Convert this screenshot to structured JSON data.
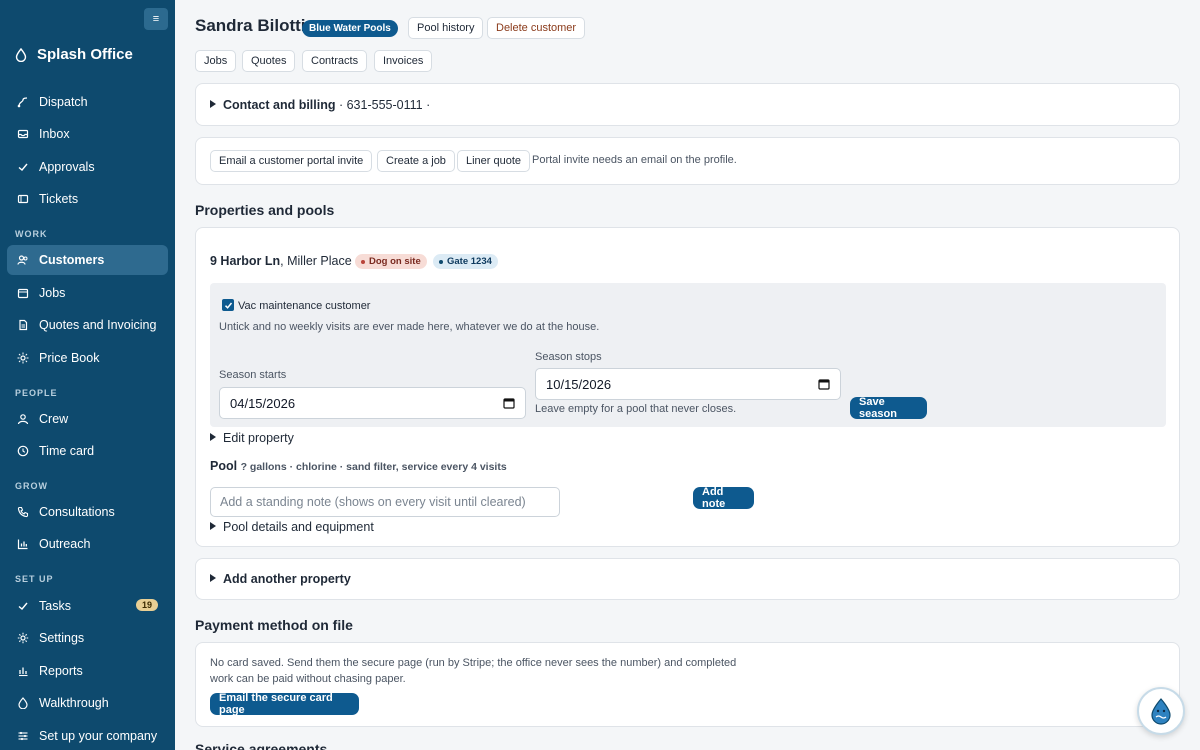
{
  "sidebar": {
    "brand": "Splash Office",
    "collapse_icon": "menu-icon",
    "items": [
      {
        "label": "Dispatch",
        "icon": "dispatch-icon"
      },
      {
        "label": "Inbox",
        "icon": "inbox-icon"
      },
      {
        "label": "Approvals",
        "icon": "check-icon"
      },
      {
        "label": "Tickets",
        "icon": "ticket-icon"
      },
      {
        "label": "Customers",
        "icon": "customers-icon"
      },
      {
        "label": "Jobs",
        "icon": "calendar-icon"
      },
      {
        "label": "Quotes and Invoicing",
        "icon": "document-icon"
      },
      {
        "label": "Price Book",
        "icon": "sun-icon"
      },
      {
        "label": "Crew",
        "icon": "person-icon"
      },
      {
        "label": "Time card",
        "icon": "clock-icon"
      },
      {
        "label": "Consultations",
        "icon": "phone-icon"
      },
      {
        "label": "Outreach",
        "icon": "chart-icon"
      },
      {
        "label": "Tasks",
        "icon": "check-icon",
        "badge": "19"
      },
      {
        "label": "Settings",
        "icon": "gear-icon"
      },
      {
        "label": "Reports",
        "icon": "reports-icon"
      },
      {
        "label": "Walkthrough",
        "icon": "drop-icon"
      },
      {
        "label": "Set up your company",
        "icon": "sliders-icon"
      }
    ],
    "sections": {
      "work": "WORK",
      "people": "PEOPLE",
      "grow": "GROW",
      "setup": "SET UP"
    }
  },
  "header": {
    "customer_name": "Sandra Bilotti",
    "brand_badge": "Blue Water Pools",
    "pool_history": "Pool history",
    "delete_customer": "Delete customer",
    "tabs": [
      "Jobs",
      "Quotes",
      "Contracts",
      "Invoices"
    ]
  },
  "contact": {
    "title": "Contact and billing",
    "summary": " · 631-555-0111 ·"
  },
  "actions": {
    "email_portal": "Email a customer portal invite",
    "create_job": "Create a job",
    "liner_quote": "Liner quote",
    "note": "Portal invite needs an email on the profile."
  },
  "properties": {
    "title": "Properties and pools",
    "address_bold": "9 Harbor Ln",
    "address_rest": ", Miller Place",
    "chips": [
      {
        "label": "Dog on site",
        "color": "#f7dcd6",
        "dot": "#b9443a",
        "text": "#7a2a20"
      },
      {
        "label": "Gate 1234",
        "color": "#dcebf5",
        "dot": "#0e4a6e",
        "text": "#0e3a5e"
      }
    ],
    "vac_label": "Vac maintenance customer",
    "vac_checked": true,
    "vac_help": "Untick and no weekly visits are ever made here, whatever we do at the house.",
    "season_starts_label": "Season starts",
    "season_starts_value": "04/15/2026",
    "season_stops_label": "Season stops",
    "season_stops_value": "10/15/2026",
    "season_stops_help": "Leave empty for a pool that never closes.",
    "save_season": "Save season",
    "edit_property": "Edit property",
    "pool_label": "Pool",
    "pool_details": "? gallons · chlorine · sand filter, service every 4 visits",
    "note_placeholder": "Add a standing note (shows on every visit until cleared)",
    "add_note": "Add note",
    "pool_equipment": "Pool details and equipment",
    "add_property": "Add another property"
  },
  "payment": {
    "title": "Payment method on file",
    "text": "No card saved. Send them the secure page (run by Stripe; the office never sees the number) and completed work can be paid without chasing paper.",
    "button": "Email the secure card page"
  },
  "service": {
    "title": "Service agreements"
  },
  "colors": {
    "sidebar": "#0e4a6e",
    "primary": "#0e5a8f",
    "badge": "#e8cf94"
  }
}
